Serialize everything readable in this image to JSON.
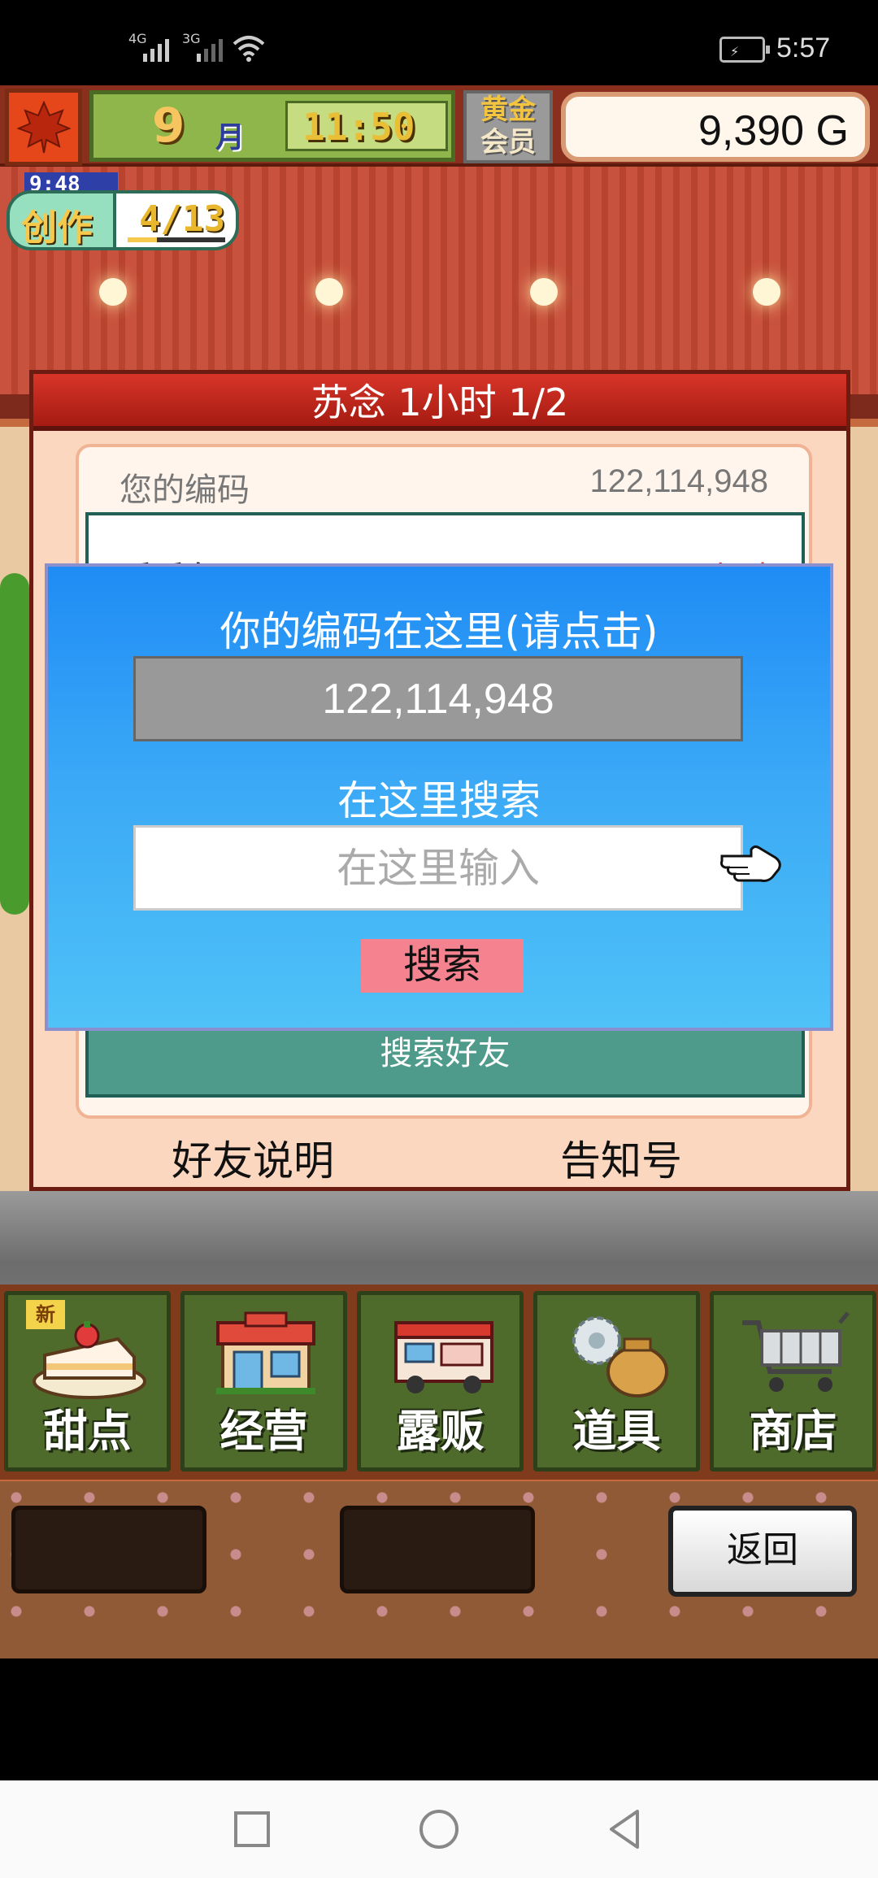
{
  "status_bar": {
    "signal_1": "4G",
    "signal_2": "3G",
    "time": "5:57"
  },
  "hud": {
    "month_number": "9",
    "month_label": "月",
    "game_time": "11:50",
    "membership_line1": "黄金",
    "membership_line2": "会员",
    "money": "9,390 G",
    "create_timer": "9:48",
    "create_label": "创作",
    "create_progress": "4/13",
    "create_progress_fraction": 0.3
  },
  "friend_panel": {
    "title": "苏念  1小时 1/2",
    "my_code_label": "您的编码",
    "my_code_value": "122,114,948",
    "list_name": "丢丢鱼",
    "list_time": "23小时",
    "search_friend_button": "搜索好友",
    "friend_explain_link": "好友说明",
    "notice_link": "告知号"
  },
  "search_dialog": {
    "title": "你的编码在这里(请点击)",
    "code": "122,114,948",
    "search_label": "在这里搜索",
    "input_placeholder": "在这里输入",
    "input_value": "",
    "search_button": "搜索"
  },
  "bottom_nav": {
    "new_tag": "新",
    "items": [
      {
        "label": "甜点"
      },
      {
        "label": "经营"
      },
      {
        "label": "露贩"
      },
      {
        "label": "道具"
      },
      {
        "label": "商店"
      }
    ]
  },
  "lower_panel": {
    "back_button": "返回"
  },
  "colors": {
    "dialog_gradient_top": "#1f8cf5",
    "dialog_gradient_bottom": "#4fc2f7",
    "search_button": "#f4828f",
    "panel_header": "#c62a1e",
    "nav_tile": "#4f6b2c"
  }
}
